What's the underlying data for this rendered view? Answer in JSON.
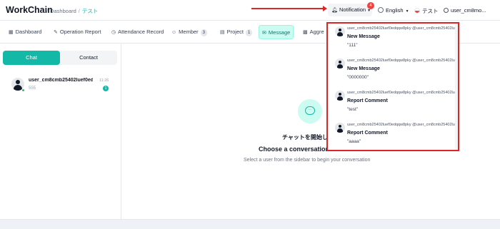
{
  "app": {
    "title": "WorkChain"
  },
  "breadcrumb": {
    "items": [
      "Dashboard",
      "テスト"
    ],
    "separator": "/"
  },
  "header": {
    "notification_label": "Notification",
    "notification_count": "4",
    "language_label": "English",
    "space_label": "テスト",
    "user_label": "user_cm8mo..."
  },
  "tabs": [
    {
      "label": "Dashboard",
      "icon": "grid-icon"
    },
    {
      "label": "Operation Report",
      "icon": "edit-icon"
    },
    {
      "label": "Attendance Record",
      "icon": "clock-icon"
    },
    {
      "label": "Member",
      "icon": "user-icon",
      "count": "3"
    },
    {
      "label": "Project",
      "icon": "document-icon",
      "count": "1"
    },
    {
      "label": "Message",
      "icon": "mail-icon",
      "active": true
    },
    {
      "label": "Aggre",
      "icon": "chart-icon"
    }
  ],
  "sidebar": {
    "chat_tab": "Chat",
    "contact_tab": "Contact",
    "conversations": [
      {
        "name": "user_cm8cmb25402luef0edqq...",
        "time": "11:26",
        "preview": "555",
        "unread": "1"
      }
    ]
  },
  "main": {
    "jp_title": "チャットを開始しま",
    "title": "Choose a conversation to",
    "subtitle": "Select a user from the sidebar to begin your conversation"
  },
  "notifications": [
    {
      "header": "user_cm8cmb25402luef0edqqw8pky @user_cm8cmb25402lu",
      "type": "New Message",
      "message": "\"111\""
    },
    {
      "header": "user_cm8cmb25402luef0edqqw8pky @user_cm8cmb25402lu",
      "type": "New Message",
      "message": "\"0000000\""
    },
    {
      "header": "user_cm8cmb25402luef0edqqw8pky @user_cm8cmb25402lu",
      "type": "Report Comment",
      "message": "\"test\""
    },
    {
      "header": "user_cm8cmb25402luef0edqqw8pky @user_cm8cmb25402lu",
      "type": "Report Comment",
      "message": "\"aaaa\""
    }
  ],
  "colors": {
    "accent": "#14b8a6",
    "highlight": "#dc2626",
    "badge": "#ef4444"
  }
}
